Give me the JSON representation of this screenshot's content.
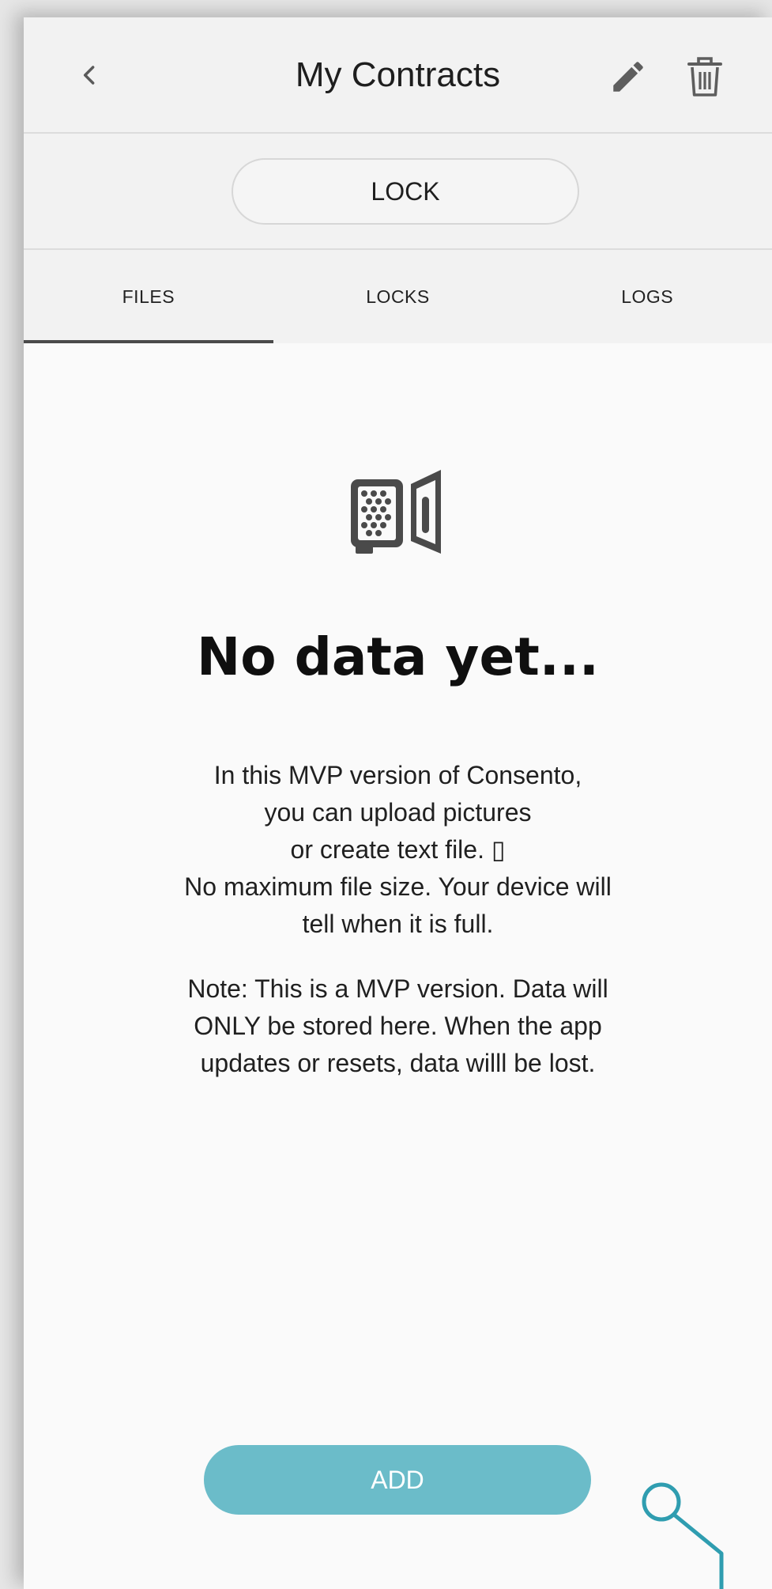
{
  "header": {
    "title": "My Contracts",
    "back_icon": "chevron-left-icon",
    "edit_icon": "pencil-icon",
    "delete_icon": "trash-icon"
  },
  "lock_button": {
    "label": "LOCK"
  },
  "tabs": [
    {
      "label": "FILES",
      "active": true
    },
    {
      "label": "LOCKS",
      "active": false
    },
    {
      "label": "LOGS",
      "active": false
    }
  ],
  "empty_state": {
    "icon": "vault-safe-icon",
    "title": "No data yet...",
    "description_lines": [
      "In this MVP version of Consento,",
      "you can upload pictures",
      "or create text file. ▯",
      "No maximum file size. Your device will",
      "tell when it is full."
    ],
    "note_lines": [
      "Note: This is a MVP version.  Data will",
      "ONLY be stored here. When the app",
      "updates or resets, data willl be lost."
    ]
  },
  "add_button": {
    "label": "ADD"
  },
  "colors": {
    "accent": "#6bbcc9",
    "header_bg": "#f2f2f2",
    "content_bg": "#fafafa",
    "tab_indicator": "#4a4a4a"
  }
}
